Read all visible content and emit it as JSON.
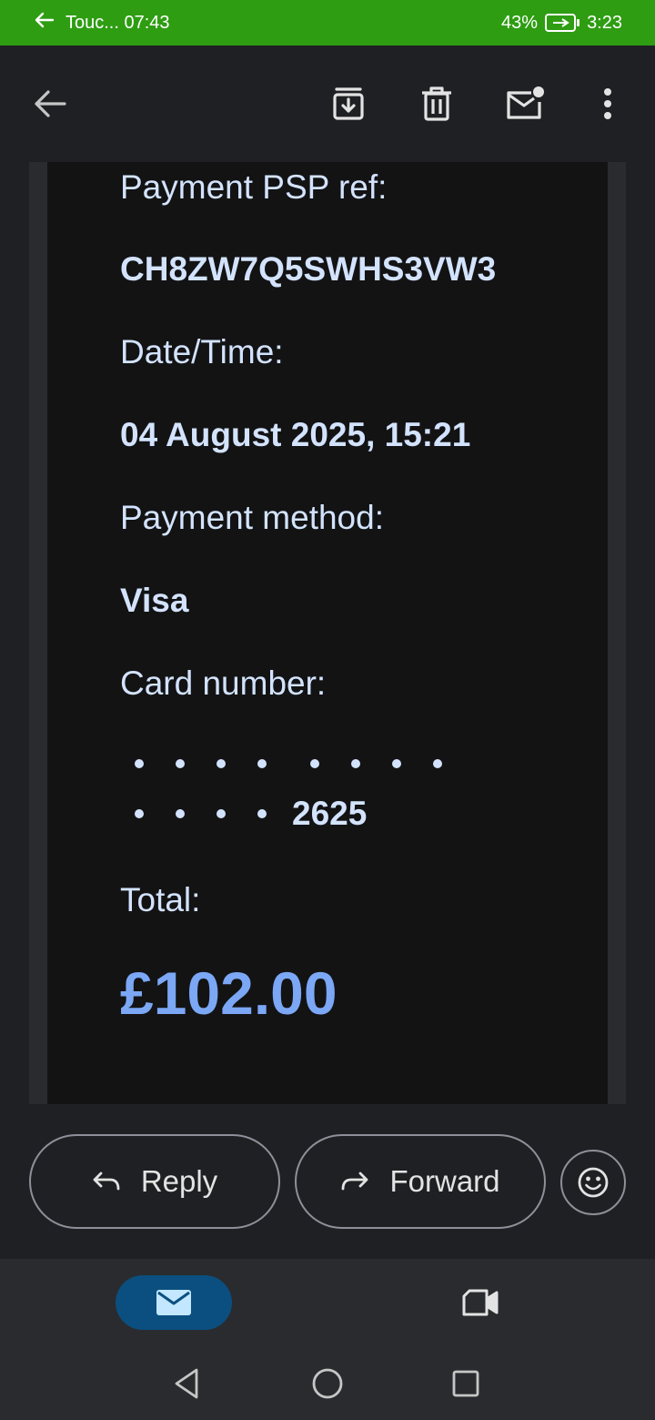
{
  "status_bar": {
    "notification_text": "Touc... 07:43",
    "battery_percent": "43%",
    "time": "3:23"
  },
  "app_bar": {
    "icons": [
      "back-arrow-icon",
      "archive-icon",
      "delete-icon",
      "mark-unread-icon",
      "more-vert-icon"
    ]
  },
  "email": {
    "psp_label": "Payment PSP ref:",
    "psp_value": "CH8ZW7Q5SWHS3VW3",
    "datetime_label": "Date/Time:",
    "datetime_value": "04 August 2025, 15:21",
    "method_label": "Payment method:",
    "method_value": "Visa",
    "card_label": "Card number:",
    "card_last4": "2625",
    "total_label": "Total:",
    "total_value": "£102.00"
  },
  "actions": {
    "reply_label": "Reply",
    "forward_label": "Forward"
  },
  "colors": {
    "status_bar": "#2e9d12",
    "background": "#1f2023",
    "email_body": "#131314",
    "text": "#d3e3fd",
    "total": "#7ba7f5",
    "nav_selected": "#0b4f80"
  }
}
